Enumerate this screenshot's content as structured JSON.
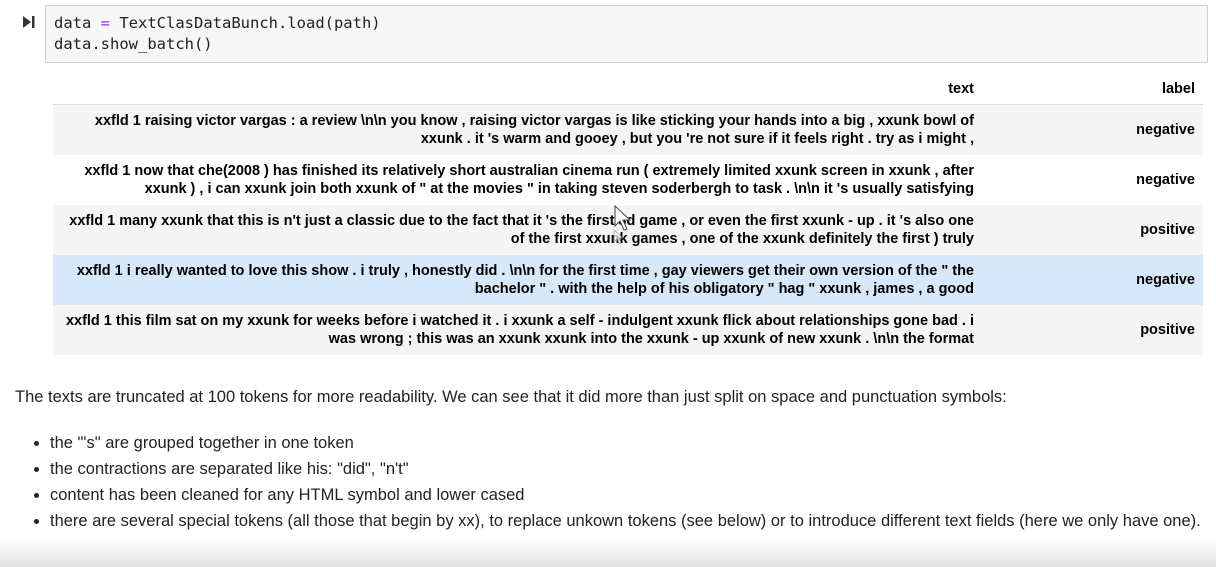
{
  "code": {
    "line1_a": "data ",
    "line1_op": "=",
    "line1_b": " TextClasDataBunch.load(path)",
    "line2": "data.show_batch()"
  },
  "table": {
    "headers": {
      "text": "text",
      "label": "label"
    },
    "rows": [
      {
        "text": "xxfld 1 raising victor vargas : a review \\n\\n you know , raising victor vargas is like sticking your hands into a big , xxunk bowl of xxunk . it 's warm and gooey , but you 're not sure if it feels right . try as i might ,",
        "label": "negative"
      },
      {
        "text": "xxfld 1 now that che(2008 ) has finished its relatively short australian cinema run ( extremely limited xxunk screen in xxunk , after xxunk ) , i can xxunk join both xxunk of \" at the movies \" in taking steven soderbergh to task . \\n\\n it 's usually satisfying",
        "label": "negative"
      },
      {
        "text": "xxfld 1 many xxunk that this is n't just a classic due to the fact that it 's the first 3d game , or even the first xxunk - up . it 's also one of the first xxunk games , one of the xxunk definitely the first ) truly",
        "label": "positive"
      },
      {
        "text": "xxfld 1 i really wanted to love this show . i truly , honestly did . \\n\\n for the first time , gay viewers get their own version of the \" the bachelor \" . with the help of his obligatory \" hag \" xxunk , james , a good",
        "label": "negative"
      },
      {
        "text": "xxfld 1 this film sat on my xxunk for weeks before i watched it . i xxunk a self - indulgent xxunk flick about relationships gone bad . i was wrong ; this was an xxunk xxunk into the xxunk - up xxunk of new xxunk . \\n\\n the format",
        "label": "positive"
      }
    ]
  },
  "markdown": {
    "paragraph": "The texts are truncated at 100 tokens for more readability. We can see that it did more than just split on space and punctuation symbols:",
    "bullets": [
      "the \"'s\" are grouped together in one token",
      "the contractions are separated like his: \"did\", \"n't\"",
      "content has been cleaned for any HTML symbol and lower cased",
      "there are several special tokens (all those that begin by xx), to replace unkown tokens (see below) or to introduce different text fields (here we only have one)."
    ]
  },
  "icons": {
    "run": "run-cell-icon",
    "cursor": "mouse-pointer-icon"
  },
  "colors": {
    "code_bg": "#f7f7f7",
    "row_hover": "#d8e8fb",
    "keyword_op": "#aa22ff"
  }
}
